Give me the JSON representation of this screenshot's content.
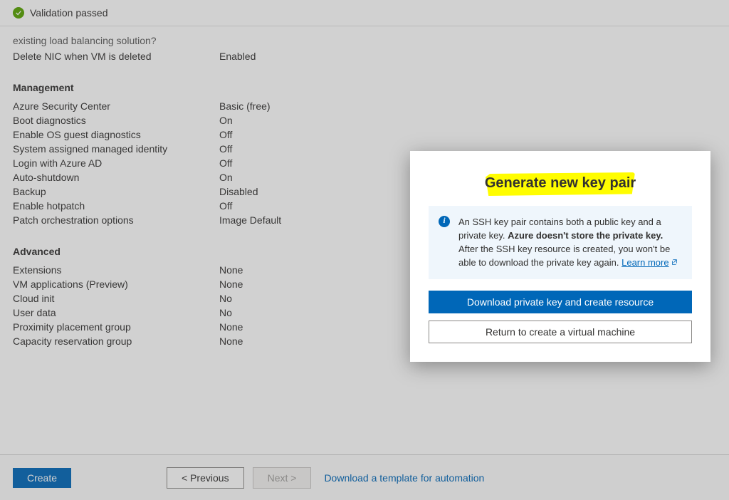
{
  "validation": {
    "text": "Validation passed"
  },
  "faded_question": "existing load balancing solution?",
  "top_row": {
    "key": "Delete NIC when VM is deleted",
    "val": "Enabled"
  },
  "sections": {
    "management": {
      "title": "Management",
      "rows": [
        {
          "key": "Azure Security Center",
          "val": "Basic (free)"
        },
        {
          "key": "Boot diagnostics",
          "val": "On"
        },
        {
          "key": "Enable OS guest diagnostics",
          "val": "Off"
        },
        {
          "key": "System assigned managed identity",
          "val": "Off"
        },
        {
          "key": "Login with Azure AD",
          "val": "Off"
        },
        {
          "key": "Auto-shutdown",
          "val": "On"
        },
        {
          "key": "Backup",
          "val": "Disabled"
        },
        {
          "key": "Enable hotpatch",
          "val": "Off"
        },
        {
          "key": "Patch orchestration options",
          "val": "Image Default"
        }
      ]
    },
    "advanced": {
      "title": "Advanced",
      "rows": [
        {
          "key": "Extensions",
          "val": "None"
        },
        {
          "key": "VM applications (Preview)",
          "val": "None"
        },
        {
          "key": "Cloud init",
          "val": "No"
        },
        {
          "key": "User data",
          "val": "No"
        },
        {
          "key": "Proximity placement group",
          "val": "None"
        },
        {
          "key": "Capacity reservation group",
          "val": "None"
        }
      ]
    }
  },
  "footer": {
    "create": "Create",
    "previous": "< Previous",
    "next": "Next >",
    "download_link": "Download a template for automation"
  },
  "dialog": {
    "title": "Generate new key pair",
    "info_pre": "An SSH key pair contains both a public key and a private key. ",
    "info_bold": "Azure doesn't store the private key.",
    "info_post": " After the SSH key resource is created, you won't be able to download the private key again. ",
    "learn_more": "Learn more",
    "download_btn": "Download private key and create resource",
    "return_btn": "Return to create a virtual machine"
  }
}
